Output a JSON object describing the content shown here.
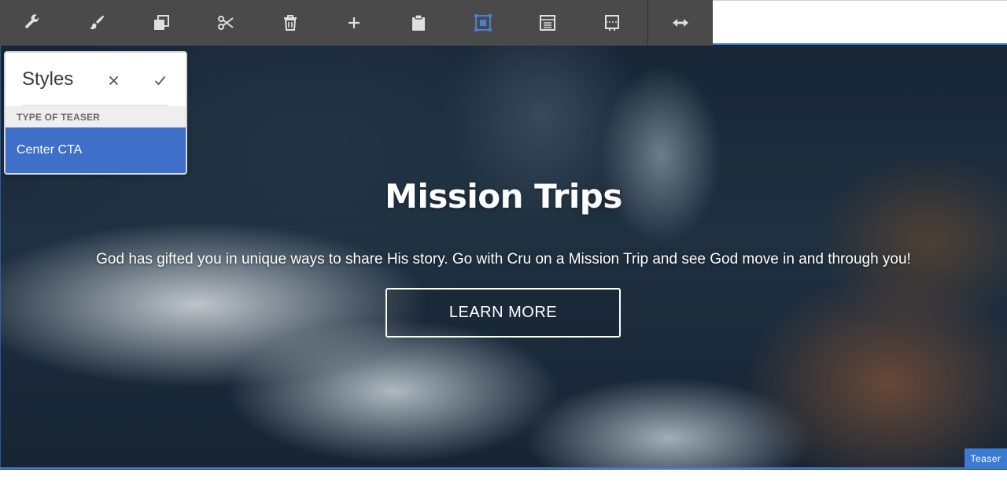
{
  "toolbar": {
    "buttons": [
      {
        "name": "configure",
        "icon": "wrench-icon"
      },
      {
        "name": "styles",
        "icon": "paintbrush-icon"
      },
      {
        "name": "copy",
        "icon": "copy-icon"
      },
      {
        "name": "cut",
        "icon": "scissors-icon"
      },
      {
        "name": "delete",
        "icon": "trash-icon"
      },
      {
        "name": "insert",
        "icon": "plus-icon"
      },
      {
        "name": "paste",
        "icon": "clipboard-icon"
      },
      {
        "name": "group",
        "icon": "group-frame-icon",
        "active": true
      },
      {
        "name": "table",
        "icon": "table-icon"
      },
      {
        "name": "layout",
        "icon": "layout-icon"
      },
      {
        "name": "resize",
        "icon": "horizontal-arrows-icon"
      }
    ],
    "colors": {
      "background": "#4a4a4a",
      "icon": "#e0e0e0",
      "active_icon": "#4a7fd4"
    }
  },
  "styles_panel": {
    "title": "Styles",
    "section_label": "TYPE OF TEASER",
    "selected_option": "Center CTA"
  },
  "teaser": {
    "title": "Mission Trips",
    "description": "God has gifted you in unique ways to share His story. Go with Cru on a Mission Trip and see God move in and through you!",
    "cta_label": "LEARN MORE",
    "badge": "Teaser"
  },
  "colors": {
    "selection": "#3b7bd4",
    "option_selected": "#3e6fc9"
  }
}
